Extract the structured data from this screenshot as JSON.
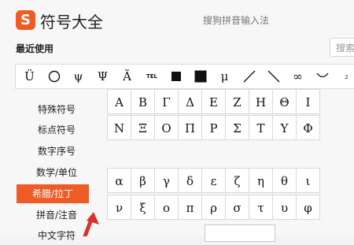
{
  "app": {
    "logo_glyph": "S",
    "title": "符号大全",
    "ime_name": "搜狗拼音输入法"
  },
  "recent": {
    "label": "最近使用",
    "search_placeholder": "搜索",
    "symbols": [
      "Ü",
      "circle-icon",
      "ψ",
      "Ψ",
      "Ã",
      "tel-icon",
      "small-black-square-icon",
      "large-black-square-icon",
      "μ",
      "slash-icon",
      "backslash-icon",
      "∞",
      "smile-curve-icon",
      "₂"
    ]
  },
  "sidebar": {
    "items": [
      "特殊符号",
      "标点符号",
      "数字序号",
      "数学/单位",
      "希腊/拉丁",
      "拼音/注音",
      "中文字符"
    ],
    "active_index": 4
  },
  "greek_upper_row1": [
    "Α",
    "Β",
    "Γ",
    "Δ",
    "Ε",
    "Ζ",
    "Η",
    "Θ",
    "Ι"
  ],
  "greek_upper_row2": [
    "Ν",
    "Ξ",
    "Ο",
    "Π",
    "Ρ",
    "Σ",
    "Τ",
    "Υ",
    "Φ"
  ],
  "greek_lower_row1": [
    "α",
    "β",
    "γ",
    "δ",
    "ε",
    "ζ",
    "η",
    "θ",
    "ι"
  ],
  "greek_lower_row2": [
    "ν",
    "ξ",
    "ο",
    "π",
    "ρ",
    "σ",
    "τ",
    "υ",
    "φ"
  ],
  "colors": {
    "accent": "#ef5b25",
    "arrow": "#d9342b"
  }
}
